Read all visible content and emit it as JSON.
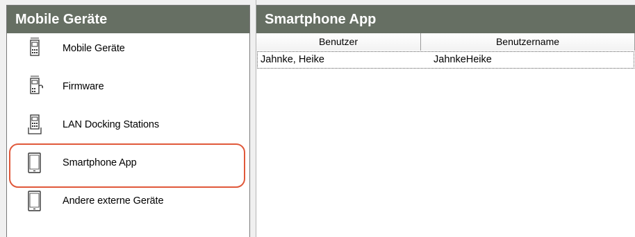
{
  "left_panel": {
    "title": "Mobile Geräte",
    "items": [
      {
        "label": "Mobile Geräte",
        "icon": "handheld-device-icon"
      },
      {
        "label": "Firmware",
        "icon": "firmware-device-icon"
      },
      {
        "label": "LAN Docking Stations",
        "icon": "docking-station-icon"
      },
      {
        "label": "Smartphone App",
        "icon": "smartphone-icon",
        "highlighted": true
      },
      {
        "label": "Andere externe Geräte",
        "icon": "external-device-icon"
      }
    ],
    "highlight_color": "#e0583a"
  },
  "right_panel": {
    "title": "Smartphone App",
    "columns": [
      "Benutzer",
      "Benutzername"
    ],
    "rows": [
      [
        "Jahnke, Heike",
        "JahnkeHeike"
      ]
    ]
  },
  "colors": {
    "header_bg": "#666f63",
    "header_text": "#ffffff",
    "app_bg": "#f0f0f0"
  }
}
